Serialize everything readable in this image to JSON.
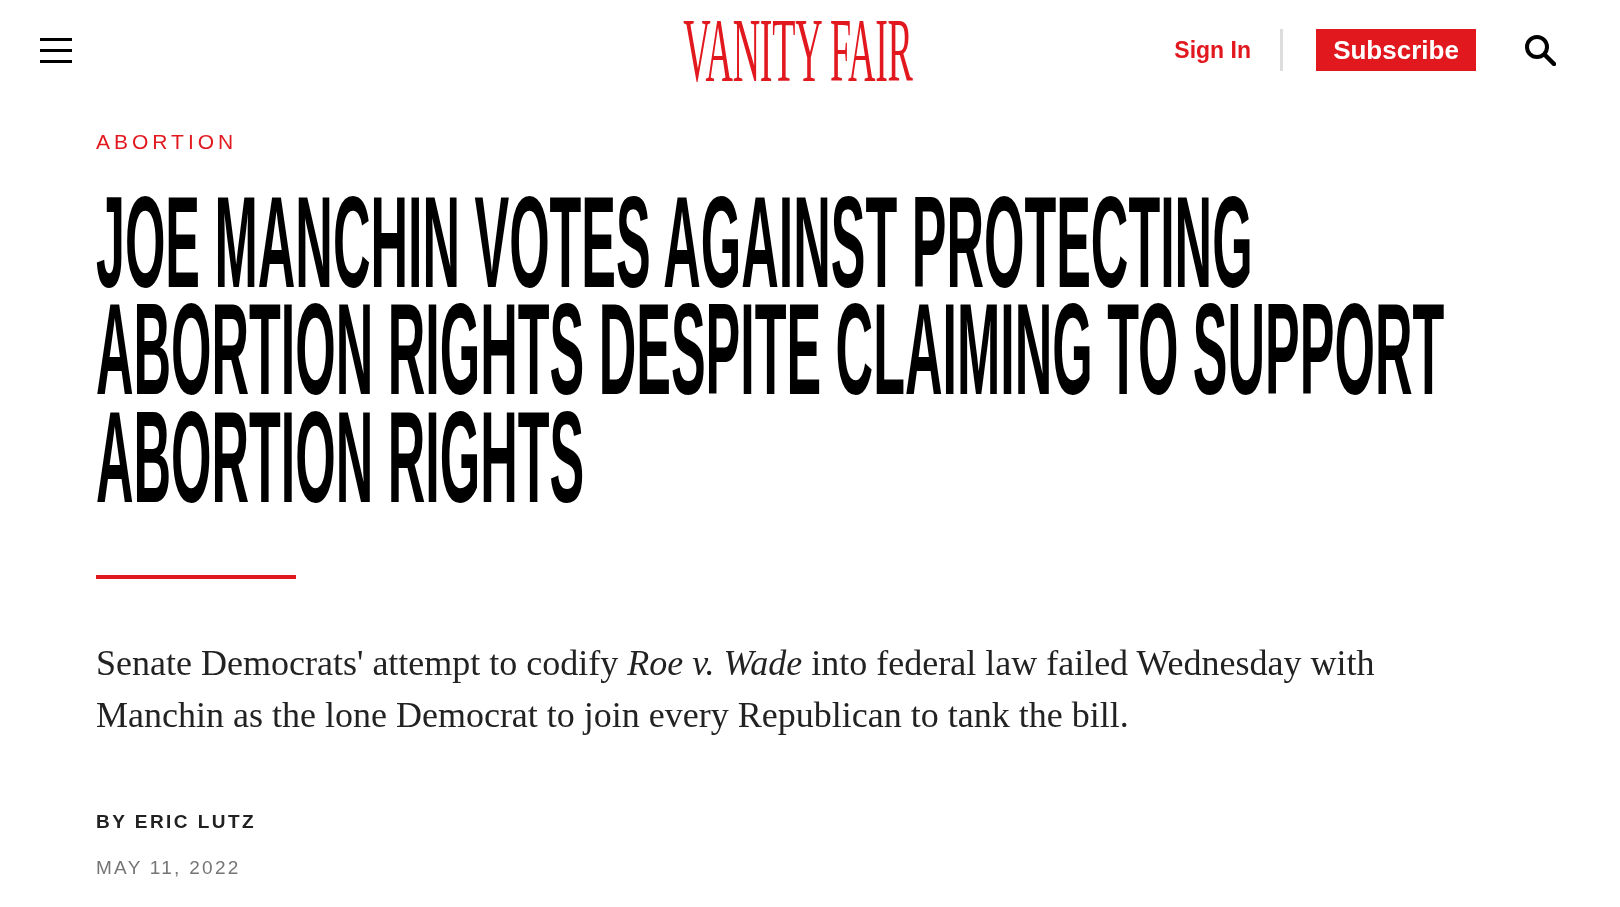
{
  "header": {
    "logo": "VANITY FAIR",
    "sign_in": "Sign In",
    "subscribe": "Subscribe"
  },
  "article": {
    "rubric": "ABORTION",
    "headline": "JOE MANCHIN VOTES AGAINST PROTECTING ABORTION RIGHTS DESPITE CLAIMING TO SUPPORT ABORTION RIGHTS",
    "dek": "Senate Democrats' attempt to codify *Roe v. Wade* into federal law failed Wednesday with Manchin as the lone Democrat to join every Republican to tank the bill.",
    "byline": "BY ERIC LUTZ",
    "date": "MAY 11, 2022"
  }
}
